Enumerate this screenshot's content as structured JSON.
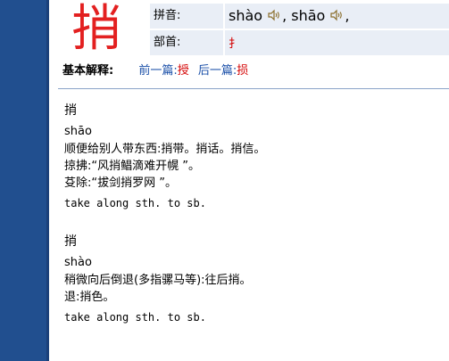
{
  "header": {
    "character": "捎",
    "pinyin_label": "拼音:",
    "pinyin_1": "shào",
    "pinyin_sep": ",",
    "pinyin_2": "shāo",
    "pinyin_end": ",",
    "radical_label": "部首:",
    "radical": "扌"
  },
  "basic": {
    "label": "基本解释:",
    "prev_label": "前一篇:",
    "prev_char": "授",
    "next_label": "后一篇:",
    "next_char": "损"
  },
  "entries": [
    {
      "char": "捎",
      "pinyin": "shāo",
      "lines": [
        "顺便给别人带东西:捎带。捎话。捎信。",
        "掠拂:“风捎鲳滴难开幌 ”。",
        "芟除:“拔剑捎罗网 ”。"
      ],
      "english": "take along sth. to sb."
    },
    {
      "char": "捎",
      "pinyin": "shào",
      "lines": [
        "稍微向后倒退(多指骡马等):往后捎。",
        "退:捎色。"
      ],
      "english": "take along sth. to sb."
    }
  ],
  "colors": {
    "sidebar": "#214f8f",
    "accent_red": "#e32020",
    "link_blue": "#1a4fa8",
    "info_bg": "#e9eef6"
  },
  "icons": {
    "speaker": "speaker-icon"
  }
}
